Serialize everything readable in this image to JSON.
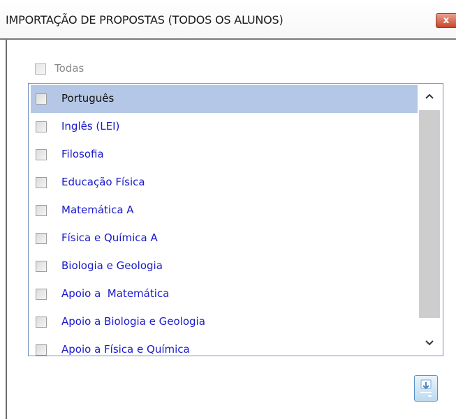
{
  "window": {
    "title": "IMPORTAÇÃO DE PROPOSTAS (TODOS OS ALUNOS)",
    "close_glyph": "x"
  },
  "select_all": {
    "label": "Todas",
    "checked": false
  },
  "list": {
    "items": [
      {
        "label": "Português",
        "checked": false,
        "selected": true
      },
      {
        "label": "Inglês (LEI)",
        "checked": false,
        "selected": false
      },
      {
        "label": "Filosofia",
        "checked": false,
        "selected": false
      },
      {
        "label": "Educação Física",
        "checked": false,
        "selected": false
      },
      {
        "label": "Matemática A",
        "checked": false,
        "selected": false
      },
      {
        "label": "Física e Química A",
        "checked": false,
        "selected": false
      },
      {
        "label": "Biologia e Geologia",
        "checked": false,
        "selected": false
      },
      {
        "label": "Apoio a  Matemática",
        "checked": false,
        "selected": false
      },
      {
        "label": "Apoio a Biologia e Geologia",
        "checked": false,
        "selected": false
      },
      {
        "label": "Apoio a Física e Química",
        "checked": false,
        "selected": false
      }
    ]
  },
  "icons": {
    "scroll_up": "chevron-up-icon",
    "scroll_down": "chevron-down-icon",
    "import": "download-icon"
  },
  "colors": {
    "item_text": "#1a1acc",
    "selection": "#b4c7e7",
    "close_button": "#c8462c"
  }
}
